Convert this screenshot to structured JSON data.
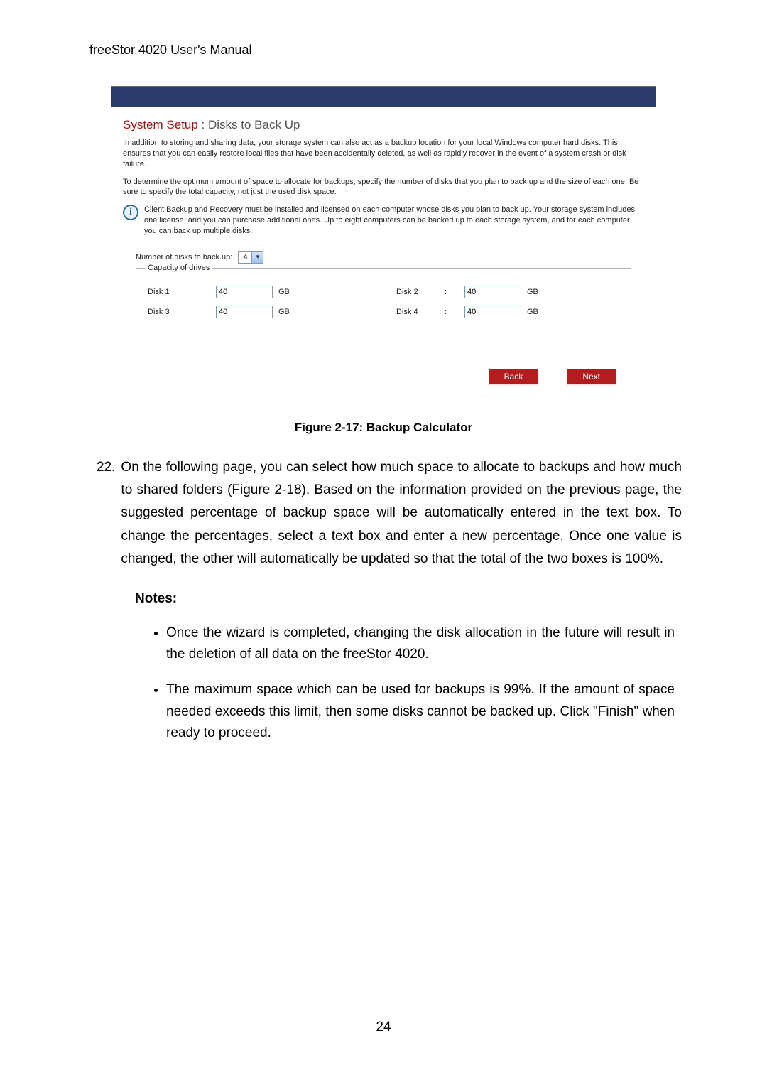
{
  "doc": {
    "header": "freeStor 4020 User's Manual",
    "page_number": "24",
    "figure_caption": "Figure 2-17: Backup Calculator",
    "step": {
      "number": "22.",
      "text": "On the following page, you can select how much space to allocate to backups and how much to shared folders (Figure 2-18). Based on the information provided on the previous page, the suggested percentage of backup space will be automatically entered in the text box. To change the percentages, select a text box and enter a new percentage. Once one value is changed, the other will automatically be updated so that the total of the two boxes is 100%."
    },
    "notes_label": "Notes:",
    "notes": [
      "Once the wizard is completed, changing the disk allocation in the future will result in the deletion of all data on the freeStor 4020.",
      "The maximum space which can be used for backups is 99%. If the amount of space needed exceeds this limit, then some disks cannot be backed up. Click \"Finish\" when ready to proceed."
    ]
  },
  "shot": {
    "heading_red": "System Setup",
    "heading_sep": " : ",
    "heading_gray": "Disks to Back Up",
    "para1": "In addition to storing and sharing data, your storage system can also act as a backup location for your local Windows computer hard disks. This ensures that you can easily restore local files that have been accidentally deleted, as well as rapidly recover in the event of a system crash or disk failure.",
    "para2": "To determine the optimum amount of space to allocate for backups, specify the number of disks that you plan to back up and the size of each one. Be sure to specify the total capacity, not just the used disk space.",
    "info": "Client Backup and Recovery must be installed and licensed on each computer whose disks you plan to back up. Your storage system includes one license, and you can purchase additional ones. Up to eight computers can be backed up to each storage system, and for each computer you can back up multiple disks.",
    "numdisks_label": "Number of disks to back up:",
    "numdisks_value": "4",
    "fieldset_legend": "Capacity of drives",
    "unit": "GB",
    "colon": ":",
    "disks": [
      {
        "label": "Disk 1",
        "value": "40"
      },
      {
        "label": "Disk 2",
        "value": "40"
      },
      {
        "label": "Disk 3",
        "value": "40"
      },
      {
        "label": "Disk 4",
        "value": "40"
      }
    ],
    "back": "Back",
    "next": "Next"
  }
}
